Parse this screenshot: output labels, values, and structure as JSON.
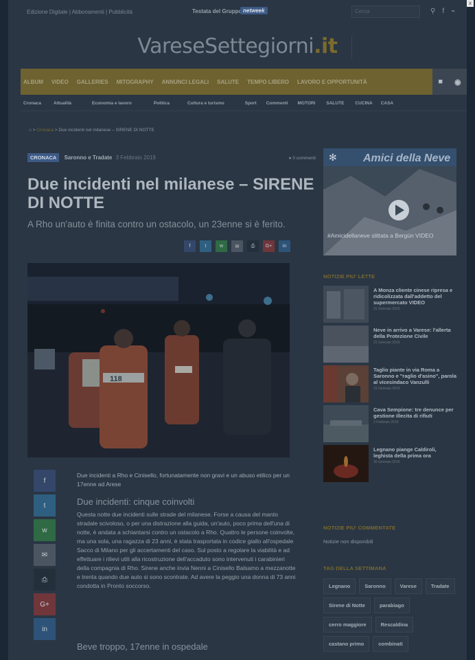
{
  "topbar": {
    "edition": "Edizione Digitale | Abbonamenti | Pubblicità",
    "testata": "Testata del Gruppo",
    "netweek": "netweek",
    "search_placeholder": "Cerca"
  },
  "logo": {
    "main": "VareseSettegiorni",
    "suffix": ".it"
  },
  "nav_main": [
    "ALBUM",
    "VIDEO",
    "GALLERIES",
    "MITOGRAPHY",
    "ANNUNCI LEGALI",
    "SALUTE",
    "TEMPO LIBERO",
    "LAVORO E OPPORTUNITÀ"
  ],
  "nav_sub": [
    "Cronaca",
    "Attualità",
    "Economia e lavoro",
    "Politica",
    "Cultura e turismo",
    "Sport",
    "Commenti",
    "MOTORI",
    "SALUTE",
    "CUCINA",
    "CASA"
  ],
  "breadcrumb": {
    "home_icon": "home-icon",
    "section": "Cronaca",
    "current": "Due incidenti nel milanese – SIRENE DI NOTTE"
  },
  "article": {
    "category": "CRONACA",
    "place": "Saronno e Tradate",
    "date": "3 Febbraio 2019",
    "comments": "0 commenti",
    "title": "Due incidenti nel milanese – SIRENE DI NOTTE",
    "subtitle": "A Rho un'auto è finita contro un ostacolo, un 23enne si è ferito.",
    "intro": "Due incidenti a Rho e Cinisello, fortunatamente non gravi e un abuso etilico per un 17enne ad Arese",
    "h1": "Due incidenti: cinque coinvolti",
    "p1": "Questa notte due incidenti sulle strade del milanese. Forse a causa del manto stradale scivoloso, o per una distrazione alla guida, un'auto, poco prima dell'una di notte, è andata a schiantarsi contro un ostacolo a Rho. Quattro le persone coinvolte, ma una sola, una ragazza di 23 anni, è stata trasportata in codice giallo all'ospedale Sacco di Milano per gli accertamenti del caso. Sul posto a regolare la viabilità e ad effettuare i rilievi utili alla ricostruzione dell'accaduto sono intervenuti i carabinieri della compagnia di Rho. Sirene anche invia Nenni a Cinisello Balsamo a mezzanotte e trenta quando due auto si sono scontrate. Ad avere la peggio una donna di 73 anni condotta in Pronto soccorso.",
    "h2": "Beve troppo, 17enne in ospedale",
    "hero_text": "118"
  },
  "share": [
    "f",
    "t",
    "w",
    "✉",
    "⎙",
    "G+",
    "in"
  ],
  "sidebar": {
    "ad_title": "Amici della Neve",
    "ad_text": "#Amicidellaneve slittata a Bergün VIDEO",
    "most_read_heading": "NOTIZIE PIU' LETTE",
    "most_read": [
      {
        "title": "A Monza cliente cinese ripresa e ridicolizzata dall'addetto del supermercato VIDEO",
        "date": "31 Gennaio 2019"
      },
      {
        "title": "Neve in arrivo a Varese: l'allerta della Protezione Civile",
        "date": "31 Gennaio 2019"
      },
      {
        "title": "Taglio piante in via Roma a Saronno e \"raglio d'asino\", parola al vicesindaco Vanzulli",
        "date": "31 Gennaio 2019"
      },
      {
        "title": "Cava Sempione: tre denunce per gestione illecita di rifiuti",
        "date": "2 Febbraio 2019"
      },
      {
        "title": "Legnano piange Caldiroli, leghista della prima ora",
        "date": "30 Gennaio 2019"
      }
    ],
    "most_commented_heading": "NOTIZIE PIU' COMMENTATE",
    "most_commented_empty": "Notizie non disponibili",
    "tags_heading": "TAG DELLA SETTIMANA",
    "tags": [
      "Legnano",
      "Saronno",
      "Varese",
      "Tradate",
      "Sirene di Notte",
      "parabiago",
      "cerro maggiore",
      "Rescaldina",
      "castano primo",
      "combinati"
    ]
  },
  "colors": {
    "accent": "#7a6a2d",
    "blue": "#3d5a86",
    "background": "#2a3644"
  }
}
